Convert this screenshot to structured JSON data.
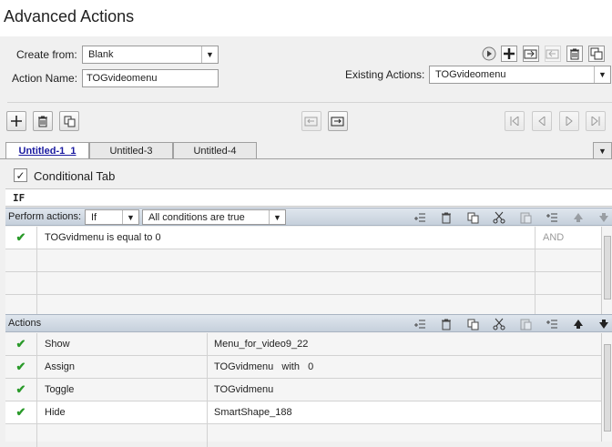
{
  "window": {
    "title": "Advanced Actions"
  },
  "form": {
    "create_from_label": "Create from:",
    "create_from_value": "Blank",
    "action_name_label": "Action Name:",
    "action_name_value": "TOGvideomenu",
    "existing_label": "Existing Actions:",
    "existing_value": "TOGvideomenu"
  },
  "tabs": [
    "Untitled-1_1",
    "Untitled-3",
    "Untitled-4"
  ],
  "conditional_label": "Conditional Tab",
  "if_label": "IF",
  "perform": {
    "label": "Perform actions:",
    "mode": "If",
    "condition": "All conditions are true"
  },
  "conditions": [
    {
      "checked": true,
      "expr": "TOGvidmenu   is equal to   0",
      "op": "AND"
    }
  ],
  "actions_label": "Actions",
  "actions": [
    {
      "checked": true,
      "action": "Show",
      "target": "Menu_for_video9_22"
    },
    {
      "checked": true,
      "action": "Assign",
      "target": "TOGvidmenu   with   0"
    },
    {
      "checked": true,
      "action": "Toggle",
      "target": "TOGvidmenu"
    },
    {
      "checked": true,
      "action": "Hide",
      "target": "SmartShape_188"
    }
  ],
  "icons": [
    "play-icon",
    "add-icon",
    "import-icon",
    "export-icon",
    "delete-icon",
    "duplicate-icon"
  ],
  "colors": {
    "check": "#2a9a2a",
    "active_tab": "#1a1aa0",
    "header_bar": "#c6d0dc"
  }
}
